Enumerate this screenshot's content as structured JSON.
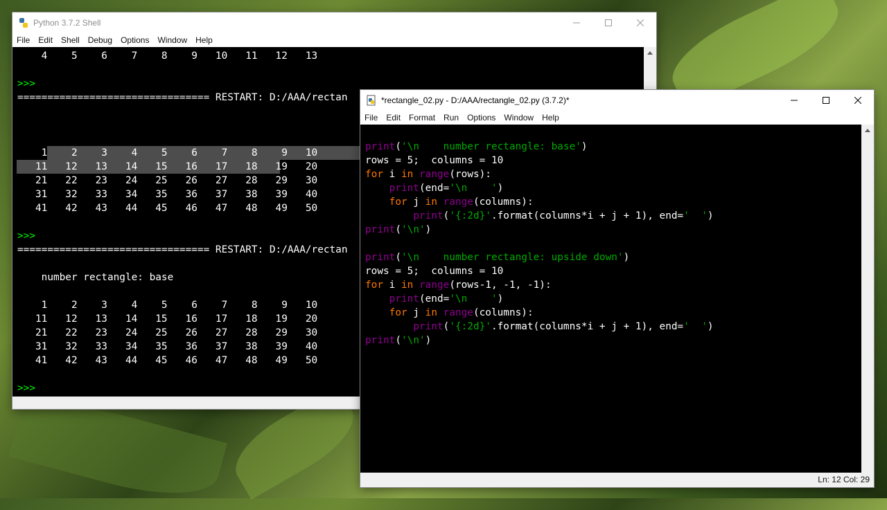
{
  "colors": {
    "keyword": "#ff7700",
    "string": "#00aa00",
    "builtin": "#900090",
    "prompt": "#00ff00",
    "text": "#ffffff",
    "background": "#000000"
  },
  "shell": {
    "title": "Python 3.7.2 Shell",
    "menu": [
      "File",
      "Edit",
      "Shell",
      "Debug",
      "Options",
      "Window",
      "Help"
    ],
    "lines": [
      "    4    5    6    7    8    9   10   11   12   13",
      "",
      ">>>",
      "================================ RESTART: D:/AAA/rectan",
      "",
      "",
      "",
      "    1    2    3    4    5    6    7    8    9   10",
      "   11   12   13   14   15   16   17   18   19   20",
      "   21   22   23   24   25   26   27   28   29   30",
      "   31   32   33   34   35   36   37   38   39   40",
      "   41   42   43   44   45   46   47   48   49   50",
      "",
      ">>>",
      "================================ RESTART: D:/AAA/rectan",
      "",
      "    number rectangle: base",
      "",
      "    1    2    3    4    5    6    7    8    9   10",
      "   11   12   13   14   15   16   17   18   19   20",
      "   21   22   23   24   25   26   27   28   29   30",
      "   31   32   33   34   35   36   37   38   39   40",
      "   41   42   43   44   45   46   47   48   49   50",
      "",
      ">>>"
    ]
  },
  "editor": {
    "title": "*rectangle_02.py - D:/AAA/rectangle_02.py (3.7.2)*",
    "menu": [
      "File",
      "Edit",
      "Format",
      "Run",
      "Options",
      "Window",
      "Help"
    ],
    "code": [
      [
        [
          "bi",
          "print"
        ],
        [
          "def",
          "("
        ],
        [
          "str",
          "'\\n    number rectangle: base'"
        ],
        [
          "def",
          ")"
        ]
      ],
      [
        [
          "def",
          "rows = 5;  columns = 10"
        ]
      ],
      [
        [
          "key",
          "for"
        ],
        [
          "def",
          " i "
        ],
        [
          "key",
          "in"
        ],
        [
          "def",
          " "
        ],
        [
          "bi",
          "range"
        ],
        [
          "def",
          "(rows):"
        ]
      ],
      [
        [
          "def",
          "    "
        ],
        [
          "bi",
          "print"
        ],
        [
          "def",
          "(end="
        ],
        [
          "str",
          "'\\n    '"
        ],
        [
          "def",
          ")"
        ]
      ],
      [
        [
          "def",
          "    "
        ],
        [
          "key",
          "for"
        ],
        [
          "def",
          " j "
        ],
        [
          "key",
          "in"
        ],
        [
          "def",
          " "
        ],
        [
          "bi",
          "range"
        ],
        [
          "def",
          "(columns):"
        ]
      ],
      [
        [
          "def",
          "        "
        ],
        [
          "bi",
          "print"
        ],
        [
          "def",
          "("
        ],
        [
          "str",
          "'{:2d}'"
        ],
        [
          "def",
          ".format(columns*i + j + 1), end="
        ],
        [
          "str",
          "'  '"
        ],
        [
          "def",
          ")"
        ]
      ],
      [
        [
          "bi",
          "print"
        ],
        [
          "def",
          "("
        ],
        [
          "str",
          "'\\n'"
        ],
        [
          "def",
          ")"
        ]
      ],
      [
        [
          "def",
          ""
        ]
      ],
      [
        [
          "bi",
          "print"
        ],
        [
          "def",
          "("
        ],
        [
          "str",
          "'\\n    number rectangle: upside down'"
        ],
        [
          "def",
          ")"
        ]
      ],
      [
        [
          "def",
          "rows = 5;  columns = 10"
        ]
      ],
      [
        [
          "key",
          "for"
        ],
        [
          "def",
          " i "
        ],
        [
          "key",
          "in"
        ],
        [
          "def",
          " "
        ],
        [
          "bi",
          "range"
        ],
        [
          "def",
          "(rows-1, -1, -1):"
        ]
      ],
      [
        [
          "def",
          "    "
        ],
        [
          "bi",
          "print"
        ],
        [
          "def",
          "(end="
        ],
        [
          "str",
          "'\\n    '"
        ],
        [
          "def",
          ")"
        ]
      ],
      [
        [
          "def",
          "    "
        ],
        [
          "key",
          "for"
        ],
        [
          "def",
          " j "
        ],
        [
          "key",
          "in"
        ],
        [
          "def",
          " "
        ],
        [
          "bi",
          "range"
        ],
        [
          "def",
          "(columns):"
        ]
      ],
      [
        [
          "def",
          "        "
        ],
        [
          "bi",
          "print"
        ],
        [
          "def",
          "("
        ],
        [
          "str",
          "'{:2d}'"
        ],
        [
          "def",
          ".format(columns*i + j + 1), end="
        ],
        [
          "str",
          "'  '"
        ],
        [
          "def",
          ")"
        ]
      ],
      [
        [
          "bi",
          "print"
        ],
        [
          "def",
          "("
        ],
        [
          "str",
          "'\\n'"
        ],
        [
          "def",
          ")"
        ]
      ]
    ],
    "status": "Ln: 12   Col: 29"
  }
}
